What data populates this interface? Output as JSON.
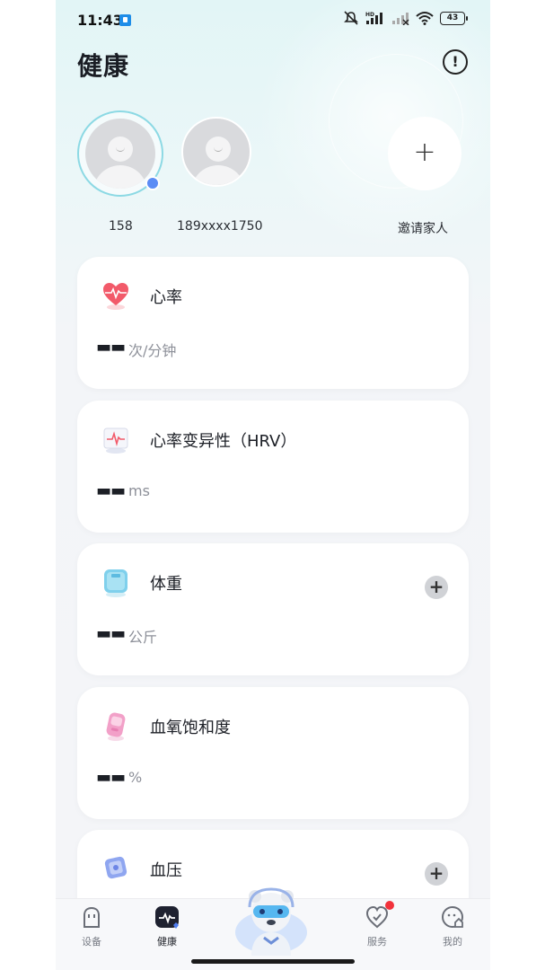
{
  "status_bar": {
    "time": "11:43",
    "battery": "43",
    "icons": [
      "notification-icon",
      "mute-icon",
      "hd-signal-icon",
      "signal-icon",
      "wifi-icon",
      "battery-icon"
    ]
  },
  "header": {
    "title": "健康",
    "info_icon": "info-icon",
    "info_label": "!"
  },
  "members": [
    {
      "name": "158",
      "selected": true
    },
    {
      "name": "189xxxx1750",
      "selected": false
    }
  ],
  "invite": {
    "label": "邀请家人",
    "icon": "plus-icon",
    "symbol": "+"
  },
  "cards": [
    {
      "title": "心率",
      "value": "▬▬",
      "unit": "次/分钟",
      "icon": "heart-rate-icon",
      "has_add": false
    },
    {
      "title": "心率变异性（HRV）",
      "value": "▬▬",
      "unit": "ms",
      "icon": "hrv-icon",
      "has_add": false
    },
    {
      "title": "体重",
      "value": "▬▬",
      "unit": "公斤",
      "icon": "weight-scale-icon",
      "has_add": true
    },
    {
      "title": "血氧饱和度",
      "value": "▬▬",
      "unit": "%",
      "icon": "blood-oxygen-icon",
      "has_add": false
    },
    {
      "title": "血压",
      "value": "",
      "unit": "",
      "icon": "blood-pressure-icon",
      "has_add": true
    }
  ],
  "add_symbol": "+",
  "tabs": [
    {
      "label": "设备",
      "icon": "device-icon",
      "active": false
    },
    {
      "label": "健康",
      "icon": "health-icon",
      "active": true
    },
    {
      "label": "服务",
      "icon": "service-icon",
      "active": false,
      "badge": true
    },
    {
      "label": "我的",
      "icon": "profile-icon",
      "active": false
    }
  ],
  "colors": {
    "accent": "#5b8cf5",
    "badge": "#f2323b",
    "heart": "#f25a6a"
  }
}
